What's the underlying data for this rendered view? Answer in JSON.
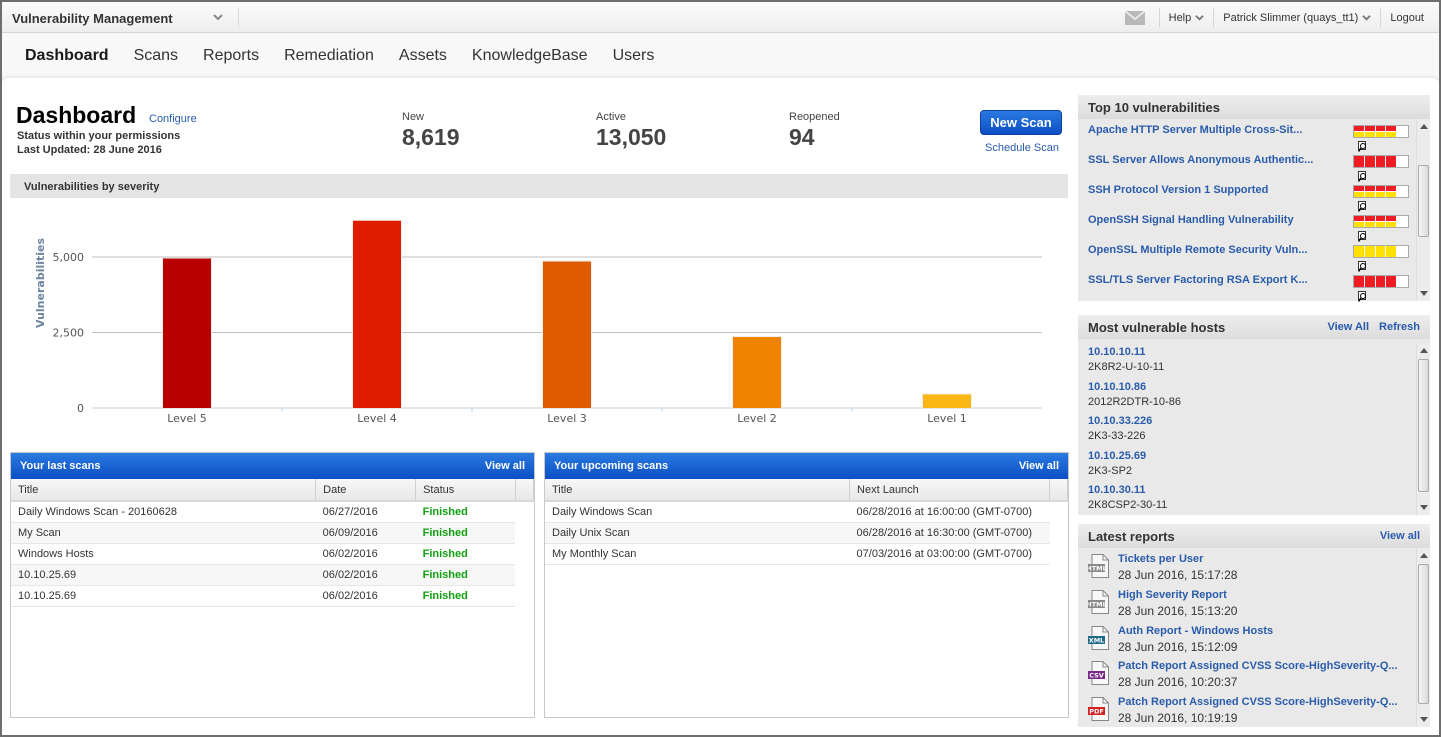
{
  "app": {
    "title": "Vulnerability Management"
  },
  "topbar": {
    "help": "Help",
    "user": "Patrick Slimmer (quays_tt1)",
    "logout": "Logout",
    "mail_icon": "envelope-icon"
  },
  "nav": [
    {
      "label": "Dashboard",
      "active": true
    },
    {
      "label": "Scans"
    },
    {
      "label": "Reports"
    },
    {
      "label": "Remediation"
    },
    {
      "label": "Assets"
    },
    {
      "label": "KnowledgeBase"
    },
    {
      "label": "Users"
    }
  ],
  "dashboard": {
    "title": "Dashboard",
    "configure": "Configure",
    "status": "Status within your permissions",
    "updated": "Last Updated: 28 June 2016",
    "stats": [
      {
        "label": "New",
        "value": "8,619"
      },
      {
        "label": "Active",
        "value": "13,050"
      },
      {
        "label": "Reopened",
        "value": "94"
      }
    ],
    "new_scan": "New Scan",
    "schedule_scan": "Schedule Scan"
  },
  "chart_panel": {
    "title": "Vulnerabilities by severity"
  },
  "chart_data": {
    "type": "bar",
    "title": "Vulnerabilities by severity",
    "xlabel": "",
    "ylabel": "Vulnerabilities",
    "categories": [
      "Level 5",
      "Level 4",
      "Level 3",
      "Level 2",
      "Level 1"
    ],
    "values": [
      4950,
      6200,
      4850,
      2350,
      450
    ],
    "colors": [
      "#b80000",
      "#e01c00",
      "#e05a00",
      "#f08400",
      "#fbb814"
    ],
    "yticks": [
      0,
      2500,
      5000
    ],
    "ytick_labels": [
      "0",
      "2,500",
      "5,000"
    ],
    "ylim": [
      0,
      6500
    ],
    "grid": true,
    "legend": "none"
  },
  "last_scans": {
    "title": "Your last scans",
    "view_all": "View all",
    "columns": [
      "Title",
      "Date",
      "Status"
    ],
    "rows": [
      [
        "Daily Windows Scan - 20160628",
        "06/27/2016",
        "Finished"
      ],
      [
        "My Scan",
        "06/09/2016",
        "Finished"
      ],
      [
        "Windows Hosts",
        "06/02/2016",
        "Finished"
      ],
      [
        "10.10.25.69",
        "06/02/2016",
        "Finished"
      ],
      [
        "10.10.25.69",
        "06/02/2016",
        "Finished"
      ]
    ]
  },
  "upcoming_scans": {
    "title": "Your upcoming scans",
    "view_all": "View all",
    "columns": [
      "Title",
      "Next Launch"
    ],
    "rows": [
      [
        "Daily Windows Scan",
        "06/28/2016 at 16:00:00 (GMT-0700)"
      ],
      [
        "Daily Unix Scan",
        "06/28/2016 at 16:30:00 (GMT-0700)"
      ],
      [
        "My Monthly Scan",
        "07/03/2016 at 03:00:00 (GMT-0700)"
      ]
    ]
  },
  "top_vulns": {
    "title": "Top 10 vulnerabilities",
    "items": [
      {
        "name": "Apache HTTP Server Multiple Cross-Sit...",
        "severity": 4,
        "style": "split"
      },
      {
        "name": "SSL Server Allows Anonymous Authentic...",
        "severity": 4,
        "style": "red"
      },
      {
        "name": "SSH Protocol Version 1 Supported",
        "severity": 4,
        "style": "split"
      },
      {
        "name": "OpenSSH Signal Handling Vulnerability",
        "severity": 4,
        "style": "split"
      },
      {
        "name": "OpenSSL Multiple Remote Security Vuln...",
        "severity": 4,
        "style": "yellow"
      },
      {
        "name": "SSL/TLS Server Factoring RSA Export K...",
        "severity": 4,
        "style": "red"
      }
    ]
  },
  "hosts": {
    "title": "Most vulnerable hosts",
    "view_all": "View All",
    "refresh": "Refresh",
    "items": [
      {
        "ip": "10.10.10.11",
        "name": "2K8R2-U-10-11"
      },
      {
        "ip": "10.10.10.86",
        "name": "2012R2DTR-10-86"
      },
      {
        "ip": "10.10.33.226",
        "name": "2K3-33-226"
      },
      {
        "ip": "10.10.25.69",
        "name": "2K3-SP2"
      },
      {
        "ip": "10.10.30.11",
        "name": "2K8CSP2-30-11"
      }
    ]
  },
  "reports": {
    "title": "Latest reports",
    "view_all": "View all",
    "items": [
      {
        "type": "HTML",
        "title": "Tickets per User",
        "date": "28 Jun 2016, 15:17:28",
        "color": "#8a8a8a"
      },
      {
        "type": "HTML",
        "title": "High Severity Report",
        "date": "28 Jun 2016, 15:13:20",
        "color": "#8a8a8a"
      },
      {
        "type": "XML",
        "title": "Auth Report - Windows Hosts",
        "date": "28 Jun 2016, 15:12:09",
        "color": "#1f6a8a"
      },
      {
        "type": "CSV",
        "title": "Patch Report Assigned CVSS Score-HighSeverity-Q...",
        "date": "28 Jun 2016, 10:20:37",
        "color": "#7a2a8a"
      },
      {
        "type": "PDF",
        "title": "Patch Report Assigned CVSS Score-HighSeverity-Q...",
        "date": "28 Jun 2016, 10:19:19",
        "color": "#d42020"
      }
    ]
  }
}
